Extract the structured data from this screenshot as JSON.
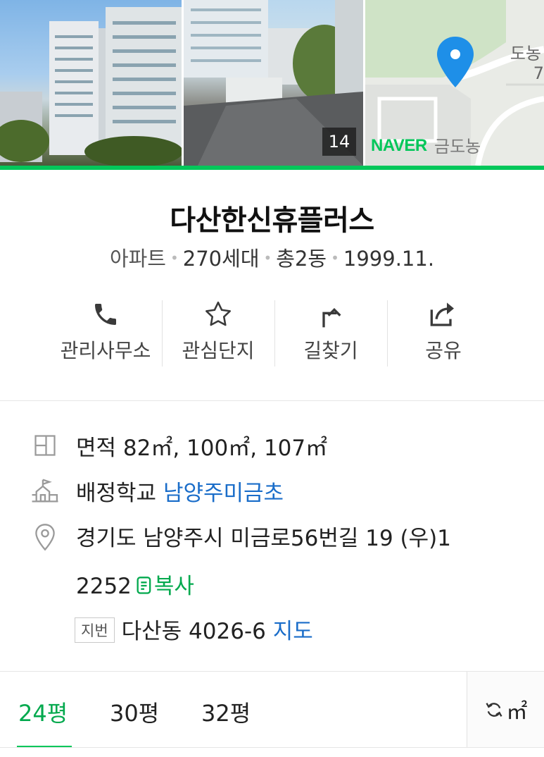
{
  "photos": {
    "count": "14",
    "map_brand": "NAVER",
    "map_labels": [
      "도농",
      "7",
      "금도농"
    ]
  },
  "complex": {
    "name": "다산한신휴플러스",
    "type": "아파트",
    "households": "270세대",
    "buildings": "총2동",
    "built": "1999.11."
  },
  "actions": [
    {
      "label": "관리사무소",
      "icon": "phone-icon"
    },
    {
      "label": "관심단지",
      "icon": "star-icon"
    },
    {
      "label": "길찾기",
      "icon": "directions-icon"
    },
    {
      "label": "공유",
      "icon": "share-icon"
    }
  ],
  "info": {
    "area_label": "면적",
    "area_values": "82㎡, 100㎡, 107㎡",
    "school_label": "배정학교",
    "school_name": "남양주미금초",
    "address_line1": "경기도 남양주시 미금로56번길 19 (우)1",
    "address_line2": "2252",
    "copy_label": "복사",
    "lot_badge": "지번",
    "lot_address": "다산동 4026-6",
    "map_link": "지도"
  },
  "tabs": {
    "items": [
      "24평",
      "30평",
      "32평"
    ],
    "active_index": 0,
    "unit_label": "㎡"
  },
  "colors": {
    "accent_green": "#03c75a",
    "link_blue": "#1a6dc9"
  }
}
